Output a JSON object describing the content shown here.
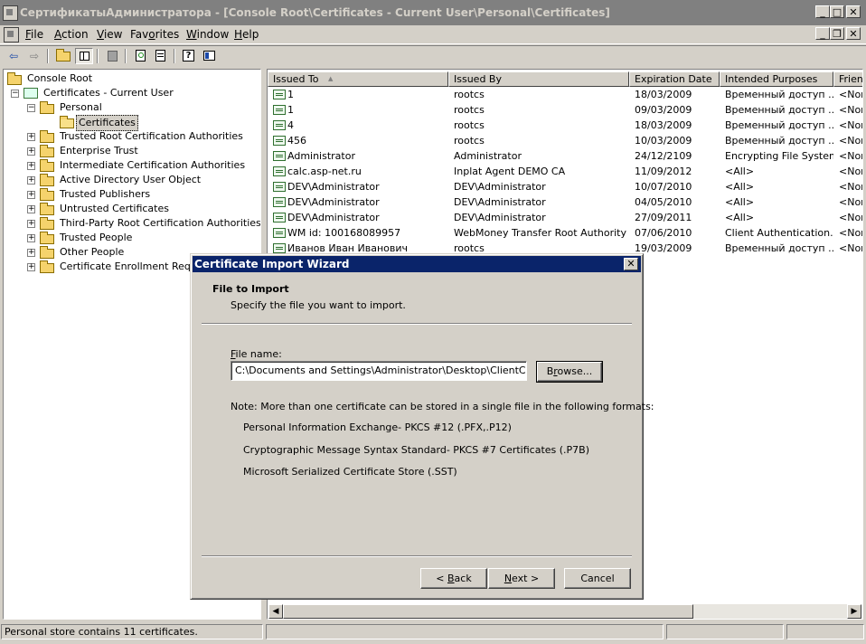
{
  "window": {
    "title": "СертификатыАдминистратора - [Console Root\\Certificates - Current User\\Personal\\Certificates]",
    "minimize_glyph": "_",
    "maximize_glyph": "□",
    "close_glyph": "✕",
    "mdi_restore_glyph": "❐"
  },
  "menu": [
    {
      "pre": "",
      "key": "F",
      "post": "ile"
    },
    {
      "pre": "",
      "key": "A",
      "post": "ction"
    },
    {
      "pre": "",
      "key": "V",
      "post": "iew"
    },
    {
      "pre": "Fav",
      "key": "o",
      "post": "rites"
    },
    {
      "pre": "",
      "key": "W",
      "post": "indow"
    },
    {
      "pre": "",
      "key": "H",
      "post": "elp"
    }
  ],
  "toolbar": {
    "back_glyph": "⇦",
    "forward_glyph": "⇨",
    "icons": [
      "back-arrow-icon",
      "forward-arrow-icon",
      "up-folder-icon",
      "show-hide-tree-icon",
      "delete-icon",
      "refresh-icon",
      "export-list-icon",
      "help-icon",
      "properties-icon"
    ]
  },
  "tree": {
    "root": "Console Root",
    "store": "Certificates - Current User",
    "personal": "Personal",
    "certificates": "Certificates",
    "children": [
      "Trusted Root Certification Authorities",
      "Enterprise Trust",
      "Intermediate Certification Authorities",
      "Active Directory User Object",
      "Trusted Publishers",
      "Untrusted Certificates",
      "Third-Party Root Certification Authorities",
      "Trusted People",
      "Other People",
      "Certificate Enrollment Reques"
    ],
    "expander_plus": "+",
    "expander_minus": "−"
  },
  "list": {
    "columns": [
      "Issued To",
      "Issued By",
      "Expiration Date",
      "Intended Purposes",
      "Friend"
    ],
    "sort_glyph": "▲",
    "rows": [
      [
        "1",
        "rootcs",
        "18/03/2009",
        "Временный доступ ...",
        "<Non"
      ],
      [
        "1",
        "rootcs",
        "09/03/2009",
        "Временный доступ ...",
        "<Non"
      ],
      [
        "4",
        "rootcs",
        "18/03/2009",
        "Временный доступ ...",
        "<Non"
      ],
      [
        "456",
        "rootcs",
        "10/03/2009",
        "Временный доступ ...",
        "<Non"
      ],
      [
        "Administrator",
        "Administrator",
        "24/12/2109",
        "Encrypting File System",
        "<Non"
      ],
      [
        "calc.asp-net.ru",
        "Inplat Agent DEMO CA",
        "11/09/2012",
        "<All>",
        "<Non"
      ],
      [
        "DEV\\Administrator",
        "DEV\\Administrator",
        "10/07/2010",
        "<All>",
        "<Non"
      ],
      [
        "DEV\\Administrator",
        "DEV\\Administrator",
        "04/05/2010",
        "<All>",
        "<Non"
      ],
      [
        "DEV\\Administrator",
        "DEV\\Administrator",
        "27/09/2011",
        "<All>",
        "<Non"
      ],
      [
        "WM id: 100168089957",
        "WebMoney Transfer Root Authority",
        "07/06/2010",
        "Client Authentication...",
        "<Non"
      ],
      [
        "Иванов Иван Иванович",
        "rootcs",
        "19/03/2009",
        "Временный доступ ...",
        "<Non"
      ]
    ]
  },
  "scroll": {
    "left_glyph": "◀",
    "right_glyph": "▶"
  },
  "status": {
    "text": "Personal store contains 11 certificates."
  },
  "dialog": {
    "title": "Certificate Import Wizard",
    "close_glyph": "✕",
    "heading": "File to Import",
    "subheading": "Specify the file you want to import.",
    "file_label_key": "F",
    "file_label_rest": "ile name:",
    "file_value": "C:\\Documents and Settings\\Administrator\\Desktop\\ClientCert\\clier",
    "browse_pre": "B",
    "browse_key": "r",
    "browse_post": "owse...",
    "note": "Note:  More than one certificate can be stored in a single file in the following formats:",
    "formats": [
      "Personal Information Exchange- PKCS #12 (.PFX,.P12)",
      "Cryptographic Message Syntax Standard- PKCS #7 Certificates (.P7B)",
      "Microsoft Serialized Certificate Store (.SST)"
    ],
    "back_pre": "< ",
    "back_key": "B",
    "back_post": "ack",
    "next_key": "N",
    "next_post": "ext >",
    "cancel": "Cancel"
  }
}
